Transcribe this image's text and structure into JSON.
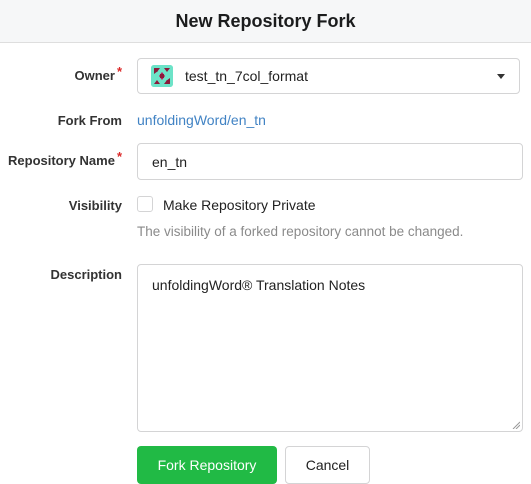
{
  "dialog": {
    "title": "New Repository Fork"
  },
  "form": {
    "owner": {
      "label": "Owner",
      "required_marker": "*",
      "selected_value": "test_tn_7col_format"
    },
    "fork_from": {
      "label": "Fork From",
      "link_text": "unfoldingWord/en_tn"
    },
    "repo_name": {
      "label": "Repository Name",
      "required_marker": "*",
      "value": "en_tn"
    },
    "visibility": {
      "label": "Visibility",
      "checkbox_label": "Make Repository Private",
      "checked": false,
      "help_text": "The visibility of a forked repository cannot be changed."
    },
    "description": {
      "label": "Description",
      "value": "unfoldingWord® Translation Notes"
    }
  },
  "actions": {
    "fork_label": "Fork Repository",
    "cancel_label": "Cancel"
  },
  "colors": {
    "primary_button": "#21ba45",
    "link": "#4183c4",
    "required": "#db2828",
    "avatar_bg": "#6de3c8",
    "avatar_fg": "#8b1a3a"
  }
}
